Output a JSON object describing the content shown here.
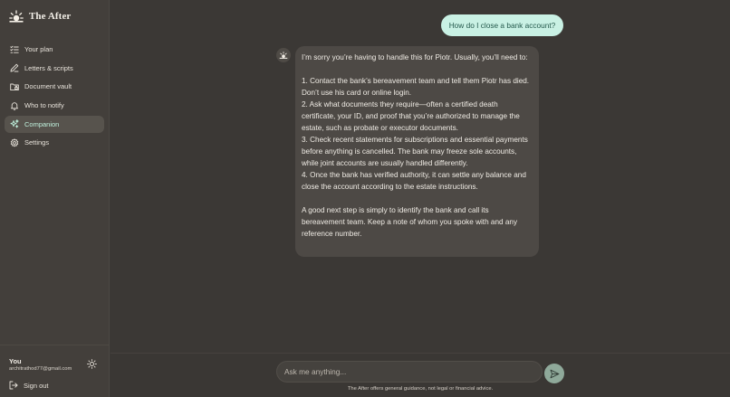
{
  "app": {
    "name": "The After"
  },
  "sidebar": {
    "items": [
      {
        "label": "Your plan",
        "icon": "checklist-icon",
        "active": false
      },
      {
        "label": "Letters & scripts",
        "icon": "pen-icon",
        "active": false
      },
      {
        "label": "Document vault",
        "icon": "folder-lock-icon",
        "active": false
      },
      {
        "label": "Who to notify",
        "icon": "bell-icon",
        "active": false
      },
      {
        "label": "Companion",
        "icon": "sparkles-icon",
        "active": true
      },
      {
        "label": "Settings",
        "icon": "gear-icon",
        "active": false
      }
    ],
    "user": {
      "name": "You",
      "email": "architrathod77@gmail.com"
    },
    "signout_label": "Sign out"
  },
  "chat": {
    "user_message": "How do I close a bank account?",
    "assistant_message": {
      "lines": [
        "I’m sorry you’re having to handle this for Piotr. Usually, you’ll need to:",
        "",
        "1. Contact the bank’s bereavement team and tell them Piotr has died. Don’t use his card or online login.",
        "2. Ask what documents they require—often a certified death certificate, your ID, and proof that you’re authorized to manage the estate, such as probate or executor documents.",
        "3. Check recent statements for subscriptions and essential payments before anything is cancelled. The bank may freeze sole accounts, while joint accounts are usually handled differently.",
        "4. Once the bank has verified authority, it can settle any balance and close the account according to the estate instructions.",
        "",
        "A good next step is simply to identify the bank and call its bereavement team. Keep a note of whom you spoke with and any reference number."
      ]
    }
  },
  "composer": {
    "placeholder": "Ask me anything...",
    "disclaimer": "The After offers general guidance, not legal or financial advice."
  },
  "colors": {
    "accent": "#c9f1e4",
    "sidebar_bg": "#433f3b",
    "main_bg": "#3b3835",
    "bubble_bg": "#4d4945",
    "send_button": "#8fa99a"
  }
}
